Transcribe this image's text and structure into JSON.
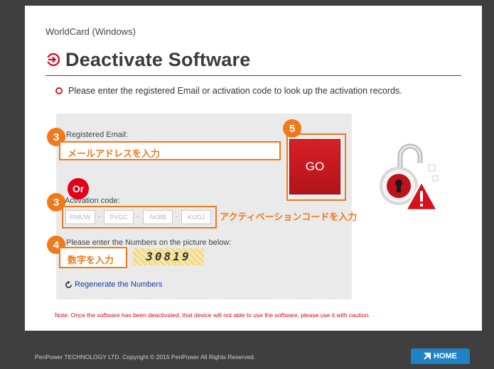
{
  "header": {
    "subtitle": "WorldCard (Windows)",
    "title": "Deactivate Software"
  },
  "instruction": "Please enter the registered Email or activation code to look up the activation records.",
  "form": {
    "email_label": "Registered Email:",
    "email_annotation": "メールアドレスを入力",
    "or_label": "Or",
    "activation_label": "Activation code:",
    "code_placeholders": [
      "RMUW",
      "PVGC",
      "AKBB",
      "KUOJ"
    ],
    "code_separator": "-",
    "code_annotation": "アクティベーションコードを入力",
    "numbers_label": "Please enter the Numbers on the picture below:",
    "numbers_annotation": "数字を入力",
    "captcha": "30819",
    "regenerate": "Regenerate the Numbers",
    "go": "GO"
  },
  "steps": {
    "email": "3",
    "code": "3",
    "numbers": "4",
    "go": "5"
  },
  "note": "Note: Once the software has been deactivated, that device will not able to use the software, please use it with caution.",
  "footer": {
    "copyright": "PenPower TECHNOLOGY LTD. Copyright © 2015 PenPower All Rights Reserved.",
    "home": "HOME"
  },
  "colors": {
    "accent": "#e2001a",
    "annotation": "#ee7a1c",
    "link": "#1a3c9a",
    "home": "#1e82c4"
  }
}
